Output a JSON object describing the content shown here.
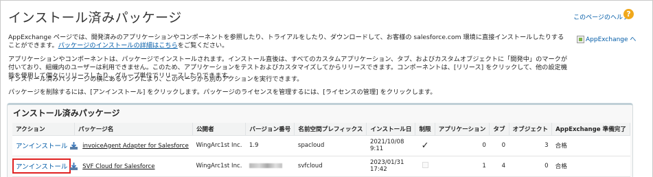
{
  "page": {
    "title": "インストール済みパッケージ",
    "help_link": "このページのヘルプ",
    "help_icon": "help-icon",
    "desc1_part1": "AppExchange ページでは、開発済みのアプリケーションやコンポーネントを参照したり、トライアルをしたり、ダウンロードして、お客様の salesforce.com 環境に直接インストールしたりすることができます。",
    "desc1_link1": "パッケージのインストールの詳細はこちら",
    "desc1_part2": "をご覧ください。",
    "appexchange_img_alt": "AppExchange へ",
    "desc2": "アプリケーションやコンポーネントは、パッケージでインストールされます。インストール直後は、すべてのカスタムアプリケーション、タブ、およびカスタムオブジェクトに「開発中」のマークが付いており、組織内のユーザーは利用できません。このため、アプリケーションをテストおよびカスタマイズしてからリリースできます。コンポーネントは、[リリース] をクリックして、他の設定機能を使用して個々にリリースしたり、グループ単位でリリースしたりできます。",
    "desc3": "インストール済みパッケージの横にあるリンクにより、このページから別のアクションを実行できます。",
    "desc4": "パッケージを削除するには、[アンインストール] をクリックします。パッケージのライセンスを管理するには、[ライセンスの管理] をクリックします。"
  },
  "panel": {
    "title": "インストール済みパッケージ",
    "columns": [
      "アクション",
      "パッケージ名",
      "公開者",
      "バージョン番号",
      "名前空間プレフィックス",
      "インストール日",
      "制限",
      "アプリケーション",
      "タブ",
      "オブジェクト",
      "AppExchange 準備完了"
    ],
    "rows": [
      {
        "action": "アンインストール",
        "name": "invoiceAgent Adapter for Salesforce",
        "publisher": "WingArc1st Inc.",
        "version": "1.9",
        "namespace": "spacloud",
        "install_date": "2021/10/08",
        "install_time": "9:11",
        "restricted": "✓",
        "apps": "0",
        "tabs": "0",
        "objects": "3",
        "ready": "合格"
      },
      {
        "action": "アンインストール",
        "name": "SVF Cloud for Salesforce",
        "publisher": "WingArc1st Inc.",
        "version": "",
        "namespace": "svfcloud",
        "install_date": "2023/01/31",
        "install_time": "17:42",
        "restricted": "",
        "apps": "1",
        "tabs": "4",
        "objects": "0",
        "ready": "合格"
      }
    ]
  }
}
